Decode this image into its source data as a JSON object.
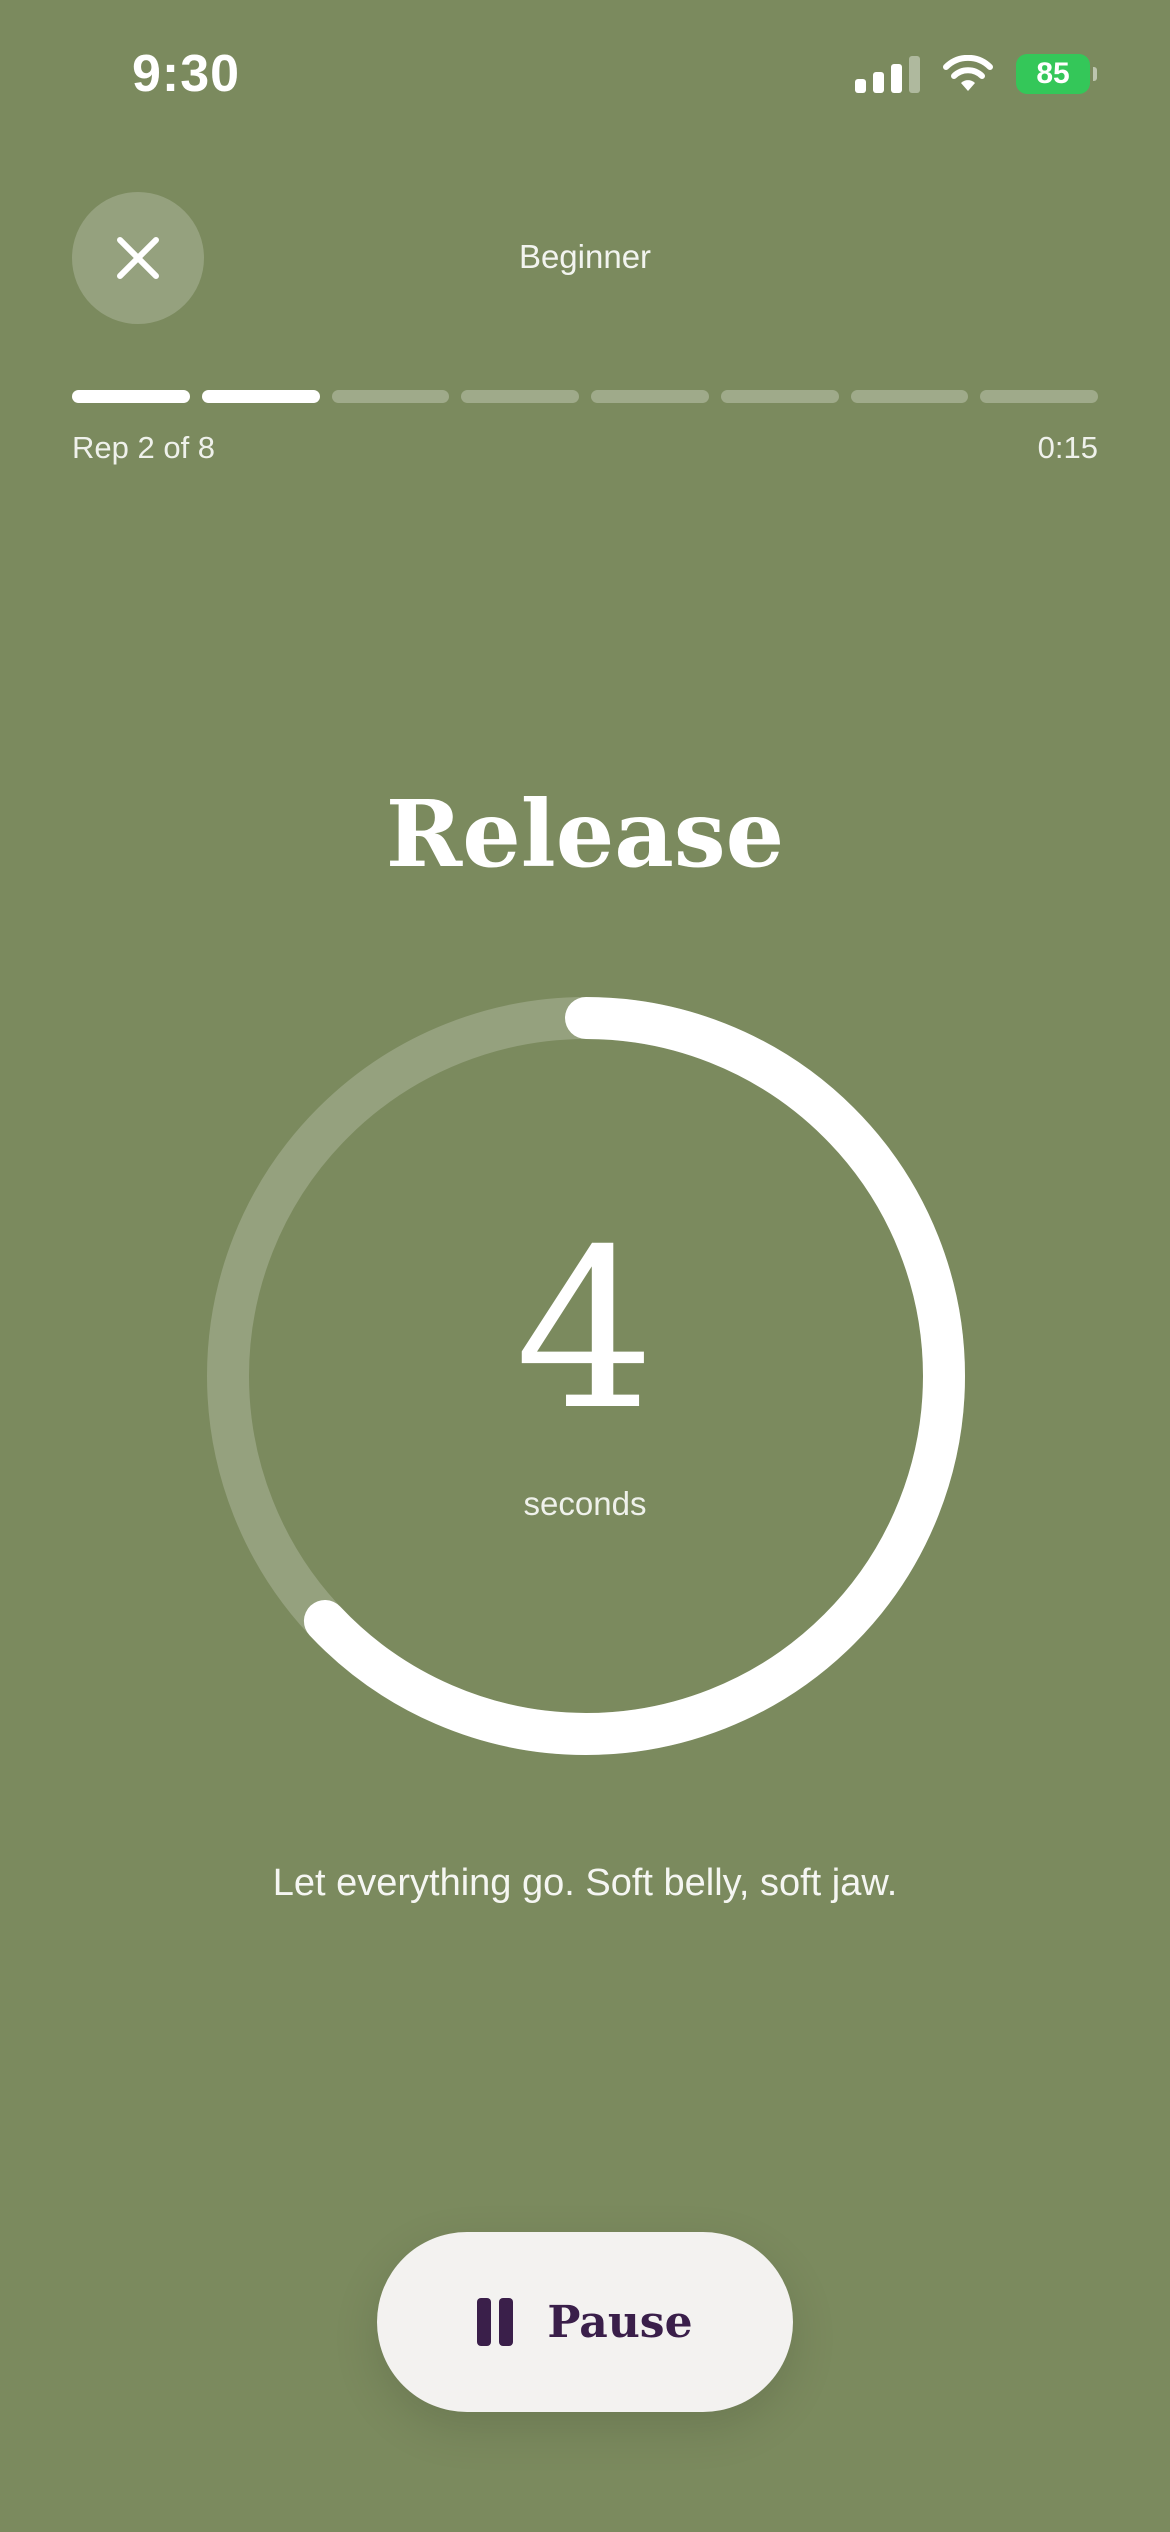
{
  "status_bar": {
    "time": "9:30",
    "battery_level": "85",
    "signal_bars_active": 3,
    "icons": [
      "cellular-signal-icon",
      "wifi-icon",
      "battery-charging-icon"
    ]
  },
  "header": {
    "close_icon": "close-icon",
    "level": "Beginner"
  },
  "progress": {
    "total_reps": 8,
    "completed_segments": 2,
    "rep_label": "Rep 2 of 8",
    "elapsed": "0:15"
  },
  "phase": {
    "name": "Release",
    "countdown": "4",
    "unit": "seconds",
    "ring_progress": 0.63,
    "instruction": "Let everything go. Soft belly, soft jaw."
  },
  "controls": {
    "pause_icon": "pause-icon",
    "pause_label": "Pause"
  },
  "colors": {
    "background": "#7b8a5e",
    "accent": "#ffffff",
    "button_background": "#f3f2f0",
    "button_text": "#3a1f4a",
    "battery": "#34c759"
  }
}
